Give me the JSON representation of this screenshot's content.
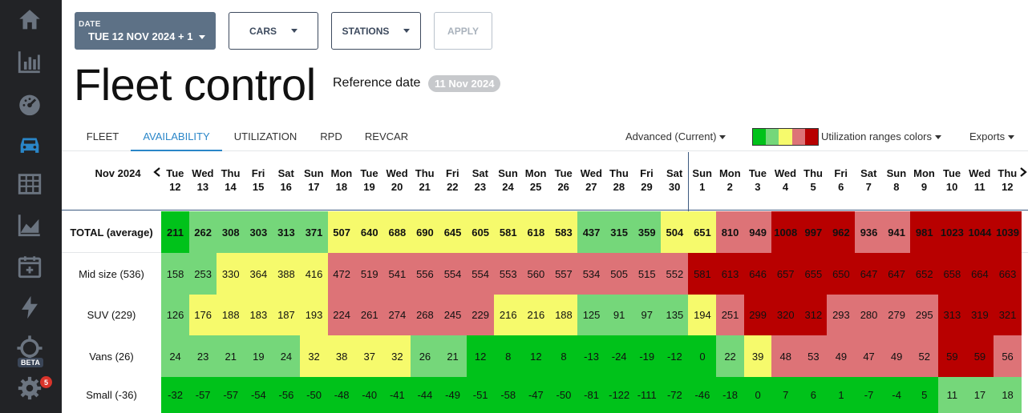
{
  "sidebar": {
    "icons": [
      "home-icon",
      "bar-chart-icon",
      "speedometer-icon",
      "car-icon",
      "table-icon",
      "area-chart-icon",
      "calendar-plus-icon",
      "lightning-icon",
      "crosshair-icon",
      "gear-icon"
    ],
    "beta_label": "BETA",
    "notification_count": "5",
    "active_color": "#2a86c8",
    "icon_color": "#6b7480"
  },
  "filters": {
    "date_caption": "DATE",
    "date_value": "TUE 12 NOV 2024 + 1",
    "cars_label": "CARS",
    "stations_label": "STATIONS",
    "apply_label": "APPLY"
  },
  "page": {
    "title": "Fleet control",
    "reference_label": "Reference date",
    "reference_date": "11 Nov 2024"
  },
  "tabs": [
    "FLEET",
    "AVAILABILITY",
    "UTILIZATION",
    "RPD",
    "REVCAR"
  ],
  "active_tab": "AVAILABILITY",
  "menus": {
    "advanced": "Advanced (Current)",
    "ranges": "Utilization ranges colors",
    "exports": "Exports"
  },
  "colors": {
    "dark_green": "#00c21a",
    "light_green": "#75d77a",
    "yellow": "#f6fa6c",
    "salmon": "#dd7377",
    "dark_red": "#b80000",
    "accent": "#2a86c8"
  },
  "legend": [
    "#00c21a",
    "#75d77a",
    "#f6fa6c",
    "#dd7377",
    "#b80000"
  ],
  "table": {
    "month_label": "Nov 2024",
    "days": [
      {
        "w": "Tue",
        "d": "12"
      },
      {
        "w": "Wed",
        "d": "13"
      },
      {
        "w": "Thu",
        "d": "14"
      },
      {
        "w": "Fri",
        "d": "15"
      },
      {
        "w": "Sat",
        "d": "16"
      },
      {
        "w": "Sun",
        "d": "17"
      },
      {
        "w": "Mon",
        "d": "18"
      },
      {
        "w": "Tue",
        "d": "19"
      },
      {
        "w": "Wed",
        "d": "20"
      },
      {
        "w": "Thu",
        "d": "21"
      },
      {
        "w": "Fri",
        "d": "22"
      },
      {
        "w": "Sat",
        "d": "23"
      },
      {
        "w": "Sun",
        "d": "24"
      },
      {
        "w": "Mon",
        "d": "25"
      },
      {
        "w": "Tue",
        "d": "26"
      },
      {
        "w": "Wed",
        "d": "27"
      },
      {
        "w": "Thu",
        "d": "28"
      },
      {
        "w": "Fri",
        "d": "29"
      },
      {
        "w": "Sat",
        "d": "30"
      },
      {
        "w": "Sun",
        "d": "1"
      },
      {
        "w": "Mon",
        "d": "2"
      },
      {
        "w": "Tue",
        "d": "3"
      },
      {
        "w": "Wed",
        "d": "4"
      },
      {
        "w": "Thu",
        "d": "5"
      },
      {
        "w": "Fri",
        "d": "6"
      },
      {
        "w": "Sat",
        "d": "7"
      },
      {
        "w": "Sun",
        "d": "8"
      },
      {
        "w": "Mon",
        "d": "9"
      },
      {
        "w": "Tue",
        "d": "10"
      },
      {
        "w": "Wed",
        "d": "11"
      },
      {
        "w": "Thu",
        "d": "12"
      }
    ],
    "rows": [
      {
        "label": "TOTAL (average)",
        "bold": true,
        "values": [
          "211",
          "262",
          "308",
          "303",
          "313",
          "371",
          "507",
          "640",
          "688",
          "690",
          "645",
          "605",
          "581",
          "618",
          "583",
          "437",
          "315",
          "359",
          "504",
          "651",
          "810",
          "949",
          "1008",
          "997",
          "962",
          "936",
          "941",
          "981",
          "1023",
          "1044",
          "1039"
        ],
        "colors": [
          "dg",
          "lg",
          "lg",
          "lg",
          "lg",
          "lg",
          "y",
          "y",
          "y",
          "y",
          "y",
          "y",
          "y",
          "y",
          "y",
          "lg",
          "lg",
          "lg",
          "y",
          "y",
          "s",
          "s",
          "r",
          "r",
          "r",
          "s",
          "s",
          "r",
          "r",
          "r",
          "r"
        ]
      },
      {
        "label": "Mid size (536)",
        "bold": false,
        "values": [
          "158",
          "253",
          "330",
          "364",
          "388",
          "416",
          "472",
          "519",
          "541",
          "556",
          "554",
          "554",
          "553",
          "560",
          "557",
          "534",
          "505",
          "515",
          "552",
          "581",
          "613",
          "646",
          "657",
          "655",
          "650",
          "647",
          "647",
          "652",
          "658",
          "664",
          "663"
        ],
        "colors": [
          "lg",
          "lg",
          "y",
          "y",
          "y",
          "y",
          "s",
          "s",
          "s",
          "s",
          "s",
          "s",
          "s",
          "s",
          "s",
          "s",
          "s",
          "s",
          "s",
          "r",
          "r",
          "r",
          "r",
          "r",
          "r",
          "r",
          "r",
          "r",
          "r",
          "r",
          "r"
        ]
      },
      {
        "label": "SUV (229)",
        "bold": false,
        "values": [
          "126",
          "176",
          "188",
          "183",
          "187",
          "193",
          "224",
          "261",
          "274",
          "268",
          "245",
          "229",
          "216",
          "216",
          "188",
          "125",
          "91",
          "97",
          "135",
          "194",
          "251",
          "299",
          "320",
          "312",
          "293",
          "280",
          "279",
          "295",
          "313",
          "319",
          "321"
        ],
        "colors": [
          "lg",
          "y",
          "y",
          "y",
          "y",
          "y",
          "s",
          "s",
          "s",
          "s",
          "s",
          "s",
          "y",
          "y",
          "y",
          "lg",
          "lg",
          "lg",
          "lg",
          "y",
          "s",
          "r",
          "r",
          "r",
          "s",
          "s",
          "s",
          "s",
          "r",
          "r",
          "r"
        ]
      },
      {
        "label": "Vans (26)",
        "bold": false,
        "values": [
          "24",
          "23",
          "21",
          "19",
          "24",
          "32",
          "38",
          "37",
          "32",
          "26",
          "21",
          "12",
          "8",
          "12",
          "8",
          "-13",
          "-24",
          "-19",
          "-12",
          "0",
          "22",
          "39",
          "48",
          "53",
          "49",
          "47",
          "49",
          "52",
          "59",
          "59",
          "56"
        ],
        "colors": [
          "lg",
          "lg",
          "lg",
          "lg",
          "lg",
          "y",
          "y",
          "y",
          "y",
          "lg",
          "lg",
          "dg",
          "dg",
          "dg",
          "dg",
          "dg",
          "dg",
          "dg",
          "dg",
          "dg",
          "lg",
          "y",
          "s",
          "s",
          "s",
          "s",
          "s",
          "s",
          "r",
          "r",
          "s"
        ]
      },
      {
        "label": "Small (-36)",
        "bold": false,
        "values": [
          "-32",
          "-57",
          "-57",
          "-54",
          "-56",
          "-50",
          "-48",
          "-40",
          "-41",
          "-44",
          "-49",
          "-51",
          "-58",
          "-47",
          "-50",
          "-81",
          "-122",
          "-111",
          "-72",
          "-46",
          "-18",
          "0",
          "7",
          "6",
          "1",
          "-7",
          "-4",
          "5",
          "11",
          "17",
          "18"
        ],
        "colors": [
          "dg",
          "dg",
          "dg",
          "dg",
          "dg",
          "dg",
          "dg",
          "dg",
          "dg",
          "dg",
          "dg",
          "dg",
          "dg",
          "dg",
          "dg",
          "dg",
          "dg",
          "dg",
          "dg",
          "dg",
          "dg",
          "dg",
          "dg",
          "dg",
          "dg",
          "dg",
          "dg",
          "dg",
          "lg",
          "lg",
          "lg"
        ]
      }
    ]
  }
}
